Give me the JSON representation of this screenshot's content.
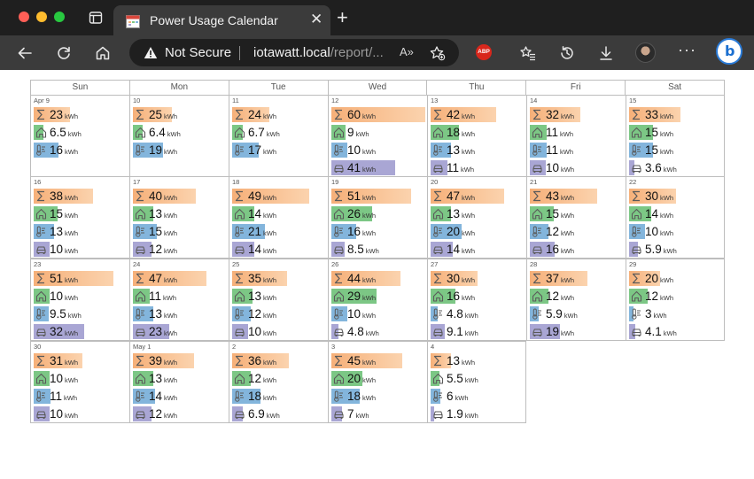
{
  "browser": {
    "tab_title": "Power Usage Calendar",
    "security_label": "Not Secure",
    "url_host": "iotawatt.local",
    "url_path": "/report/...",
    "read_aloud_label": "A»",
    "adblock_label": "ABP",
    "more_label": "···",
    "copilot_label": "b"
  },
  "colors": {
    "total": "#f6b079",
    "house": "#7cc785",
    "hvac": "#83b5dc",
    "ev": "#a9a6d4"
  },
  "calendar": {
    "weekdays": [
      "Sun",
      "Mon",
      "Tue",
      "Wed",
      "Thu",
      "Fri",
      "Sat"
    ],
    "unit": "kWh",
    "weeks": [
      [
        {
          "label": "Apr 9",
          "total": "23",
          "house": "6.5",
          "hvac": "16",
          "ev": null
        },
        {
          "label": "10",
          "total": "25",
          "house": "6.4",
          "hvac": "19",
          "ev": null
        },
        {
          "label": "11",
          "total": "24",
          "house": "6.7",
          "hvac": "17",
          "ev": null
        },
        {
          "label": "12",
          "total": "60",
          "house": "9",
          "hvac": "10",
          "ev": "41"
        },
        {
          "label": "13",
          "total": "42",
          "house": "18",
          "hvac": "13",
          "ev": "11"
        },
        {
          "label": "14",
          "total": "32",
          "house": "11",
          "hvac": "11",
          "ev": "10"
        },
        {
          "label": "15",
          "total": "33",
          "house": "15",
          "hvac": "15",
          "ev": "3.6"
        }
      ],
      [
        {
          "label": "16",
          "total": "38",
          "house": "15",
          "hvac": "13",
          "ev": "10"
        },
        {
          "label": "17",
          "total": "40",
          "house": "13",
          "hvac": "15",
          "ev": "12"
        },
        {
          "label": "18",
          "total": "49",
          "house": "14",
          "hvac": "21",
          "ev": "14"
        },
        {
          "label": "19",
          "total": "51",
          "house": "26",
          "hvac": "16",
          "ev": "8.5"
        },
        {
          "label": "20",
          "total": "47",
          "house": "13",
          "hvac": "20",
          "ev": "14"
        },
        {
          "label": "21",
          "total": "43",
          "house": "15",
          "hvac": "12",
          "ev": "16"
        },
        {
          "label": "22",
          "total": "30",
          "house": "14",
          "hvac": "10",
          "ev": "5.9"
        }
      ],
      [
        {
          "label": "23",
          "total": "51",
          "house": "10",
          "hvac": "9.5",
          "ev": "32"
        },
        {
          "label": "24",
          "total": "47",
          "house": "11",
          "hvac": "13",
          "ev": "23"
        },
        {
          "label": "25",
          "total": "35",
          "house": "13",
          "hvac": "12",
          "ev": "10"
        },
        {
          "label": "26",
          "total": "44",
          "house": "29",
          "hvac": "10",
          "ev": "4.8"
        },
        {
          "label": "27",
          "total": "30",
          "house": "16",
          "hvac": "4.8",
          "ev": "9.1"
        },
        {
          "label": "28",
          "total": "37",
          "house": "12",
          "hvac": "5.9",
          "ev": "19"
        },
        {
          "label": "29",
          "total": "20",
          "house": "12",
          "hvac": "3",
          "ev": "4.1"
        }
      ],
      [
        {
          "label": "30",
          "total": "31",
          "house": "10",
          "hvac": "11",
          "ev": "10"
        },
        {
          "label": "May 1",
          "total": "39",
          "house": "13",
          "hvac": "14",
          "ev": "12"
        },
        {
          "label": "2",
          "total": "36",
          "house": "12",
          "hvac": "18",
          "ev": "6.9"
        },
        {
          "label": "3",
          "total": "45",
          "house": "20",
          "hvac": "18",
          "ev": "7"
        },
        {
          "label": "4",
          "total": "13",
          "house": "5.5",
          "hvac": "6",
          "ev": "1.9"
        }
      ]
    ]
  }
}
